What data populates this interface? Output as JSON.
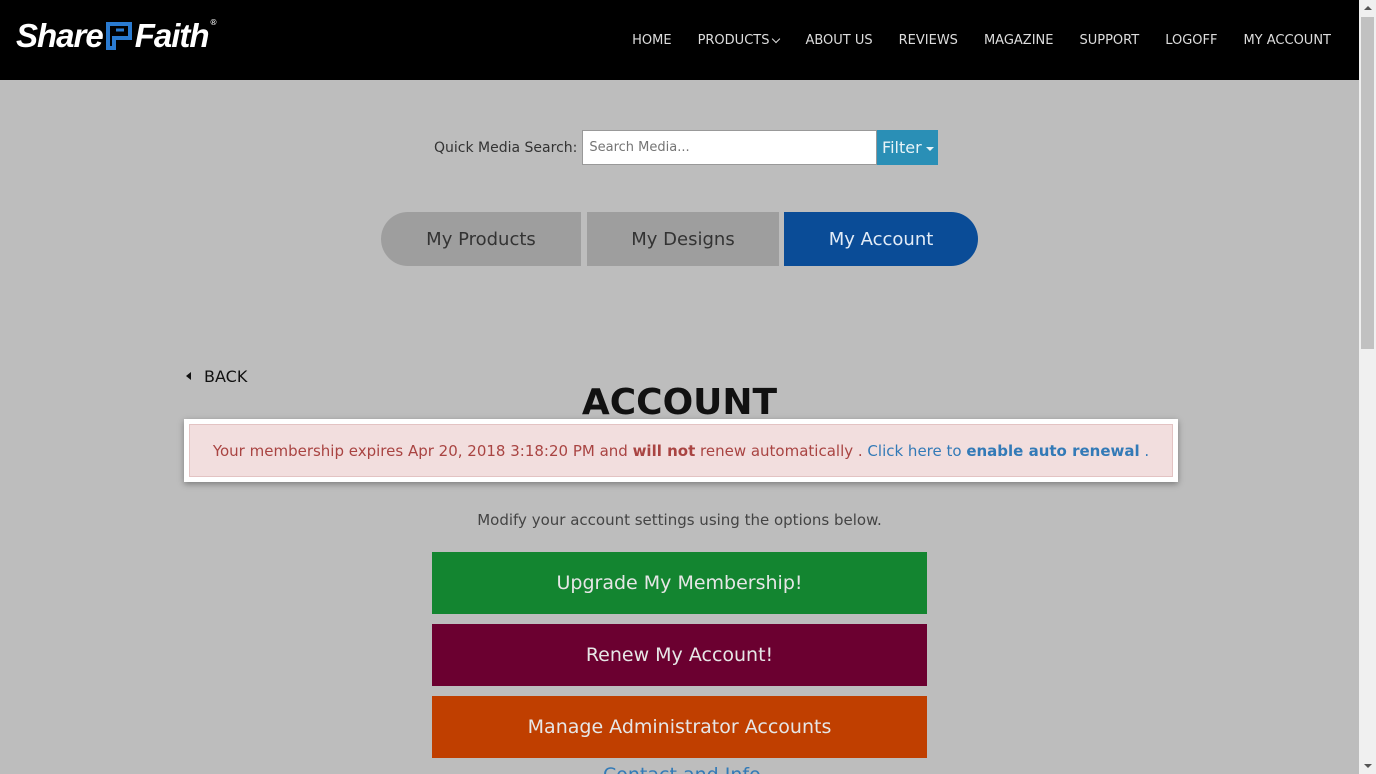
{
  "header": {
    "logo": {
      "text_left": "Share",
      "text_right": "Faith",
      "tm": "®",
      "mark_color": "#2a7bd1"
    },
    "nav": [
      {
        "label": "HOME"
      },
      {
        "label": "PRODUCTS"
      },
      {
        "label": "ABOUT US"
      },
      {
        "label": "REVIEWS"
      },
      {
        "label": "MAGAZINE"
      },
      {
        "label": "SUPPORT"
      },
      {
        "label": "LOGOFF"
      },
      {
        "label": "MY ACCOUNT"
      }
    ]
  },
  "search": {
    "label": "Quick Media Search:",
    "placeholder": "Search Media...",
    "filter_label": "Filter"
  },
  "tabs": [
    {
      "label": "My Products"
    },
    {
      "label": "My Designs"
    },
    {
      "label": "My Account",
      "active": true
    }
  ],
  "back_label": "BACK",
  "page_title": "ACCOUNT",
  "alert": {
    "text_1": "Your membership expires Apr 20, 2018 3:18:20 PM and ",
    "bold_1": "will not",
    "text_2": " renew automatically . ",
    "link_text": "Click here to ",
    "link_bold": "enable auto renewal",
    "link_tail": " ."
  },
  "subtext": "Modify your account settings using the options below.",
  "buttons": {
    "upgrade": "Upgrade My Membership!",
    "renew": "Renew My Account!",
    "manage": "Manage Administrator Accounts",
    "cut_off": "Contact and Info"
  },
  "colors": {
    "topbar": "#000000",
    "active_tab": "#0a4c97",
    "filter": "#2a8fb6",
    "upgrade": "#138530",
    "renew": "#6b0030",
    "manage": "#c03f00",
    "alert_bg": "#f2dede",
    "alert_text": "#a94442",
    "link": "#337ab7"
  }
}
